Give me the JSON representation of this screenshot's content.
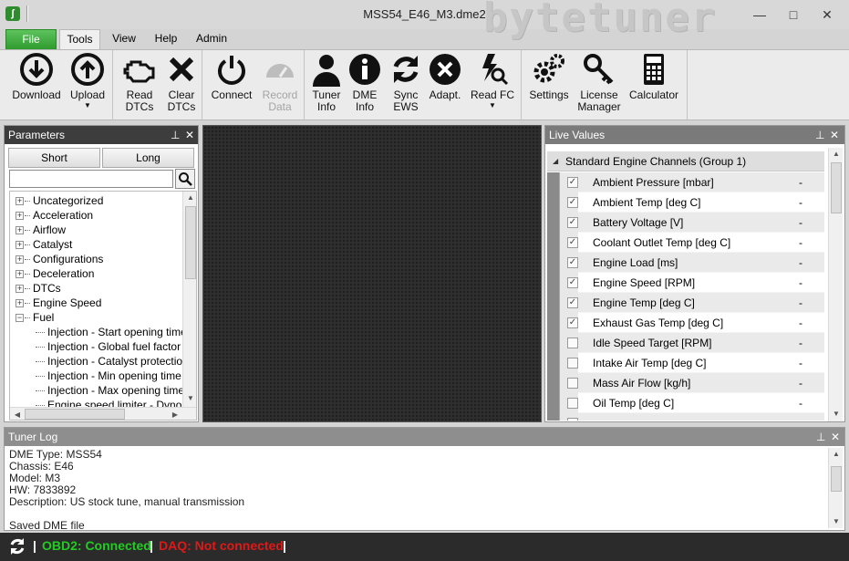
{
  "window": {
    "title": "MSS54_E46_M3.dme2",
    "brand": "bytetuner",
    "minimize": "—",
    "maximize": "□",
    "close": "✕"
  },
  "menu": {
    "file": "File",
    "tools": "Tools",
    "view": "View",
    "help": "Help",
    "admin": "Admin"
  },
  "ribbon": {
    "download": "Download",
    "upload": "Upload",
    "read_dtcs": [
      "Read",
      "DTCs"
    ],
    "clear_dtcs": [
      "Clear",
      "DTCs"
    ],
    "connect": "Connect",
    "record_data": [
      "Record",
      "Data"
    ],
    "tuner_info": [
      "Tuner",
      "Info"
    ],
    "dme_info": [
      "DME",
      "Info"
    ],
    "sync_ews": [
      "Sync",
      "EWS"
    ],
    "adapt": "Adapt.",
    "read_fc": "Read FC",
    "settings": "Settings",
    "license_manager": [
      "License",
      "Manager"
    ],
    "calculator": "Calculator"
  },
  "parameters": {
    "title": "Parameters",
    "tab_short": "Short",
    "tab_long": "Long",
    "search_value": "",
    "tree": [
      {
        "label": "Uncategorized",
        "level": 0,
        "expander": "+"
      },
      {
        "label": "Acceleration",
        "level": 0,
        "expander": "+"
      },
      {
        "label": "Airflow",
        "level": 0,
        "expander": "+"
      },
      {
        "label": "Catalyst",
        "level": 0,
        "expander": "+"
      },
      {
        "label": "Configurations",
        "level": 0,
        "expander": "+"
      },
      {
        "label": "Deceleration",
        "level": 0,
        "expander": "+"
      },
      {
        "label": "DTCs",
        "level": 0,
        "expander": "+"
      },
      {
        "label": "Engine Speed",
        "level": 0,
        "expander": "+"
      },
      {
        "label": "Fuel",
        "level": 0,
        "expander": "−"
      },
      {
        "label": "Injection - Start opening time",
        "level": 1
      },
      {
        "label": "Injection - Global fuel factor",
        "level": 1
      },
      {
        "label": "Injection - Catalyst protection",
        "level": 1
      },
      {
        "label": "Injection - Min opening time",
        "level": 1
      },
      {
        "label": "Injection - Max opening time",
        "level": 1
      },
      {
        "label": "Engine speed limiter - Dyno",
        "level": 1
      }
    ]
  },
  "live_values": {
    "title": "Live Values",
    "group": "Standard Engine Channels (Group 1)",
    "rows": [
      {
        "name": "Ambient Pressure [mbar]",
        "checked": true,
        "value": "-"
      },
      {
        "name": "Ambient Temp [deg C]",
        "checked": true,
        "value": "-"
      },
      {
        "name": "Battery Voltage [V]",
        "checked": true,
        "value": "-"
      },
      {
        "name": "Coolant Outlet Temp [deg C]",
        "checked": true,
        "value": "-"
      },
      {
        "name": "Engine Load [ms]",
        "checked": true,
        "value": "-"
      },
      {
        "name": "Engine Speed [RPM]",
        "checked": true,
        "value": "-"
      },
      {
        "name": "Engine Temp [deg C]",
        "checked": true,
        "value": "-"
      },
      {
        "name": "Exhaust Gas Temp [deg C]",
        "checked": true,
        "value": "-"
      },
      {
        "name": "Idle Speed Target [RPM]",
        "checked": false,
        "value": "-"
      },
      {
        "name": "Intake Air Temp [deg C]",
        "checked": false,
        "value": "-"
      },
      {
        "name": "Mass Air Flow [kg/h]",
        "checked": false,
        "value": "-"
      },
      {
        "name": "Oil Temp [deg C]",
        "checked": false,
        "value": "-"
      },
      {
        "name": "",
        "checked": false,
        "value": ""
      }
    ]
  },
  "tuner_log": {
    "title": "Tuner Log",
    "lines": "DME Type: MSS54\nChassis: E46\nModel: M3\nHW: 7833892\nDescription: US stock tune, manual transmission\n\nSaved DME file"
  },
  "status": {
    "obd2": "OBD2: Connected",
    "daq": "DAQ: Not connected",
    "sep": "|",
    "colors": {
      "ok": "#22cc22",
      "err": "#e01818"
    }
  },
  "icons": {
    "pin": "pin-icon",
    "close": "close-icon"
  }
}
